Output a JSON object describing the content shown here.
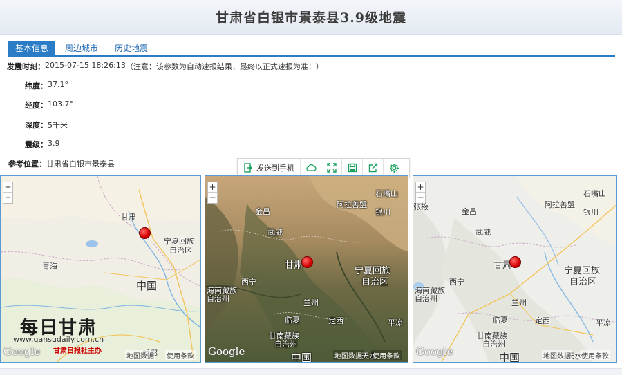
{
  "page": {
    "title": "甘肃省白银市景泰县3.9级地震"
  },
  "tabs": [
    {
      "label": "基本信息",
      "active": true
    },
    {
      "label": "周边城市",
      "active": false
    },
    {
      "label": "历史地震",
      "active": false
    }
  ],
  "info": {
    "time_label": "发震时刻：",
    "time_value": "2015-07-15 18:26:13",
    "time_note": "（注意：该参数为自动速报结果，最终以正式速报为准！）",
    "lat_label": "纬度：",
    "lat_value": "37.1°",
    "lon_label": "经度：",
    "lon_value": "103.7°",
    "depth_label": "深度：",
    "depth_value": "5千米",
    "mag_label": "震级：",
    "mag_value": "3.9",
    "loc_label": "参考位置：",
    "loc_value": "甘肃省白银市景泰县"
  },
  "toolbar": {
    "send_label": "发送到手机",
    "icons": [
      "phone-send-icon",
      "cloud-icon",
      "fullscreen-icon",
      "save-icon",
      "share-icon",
      "gear-icon"
    ],
    "accent": "#19a15f"
  },
  "map_common": {
    "zoom_in": "+",
    "zoom_out": "−",
    "google": "Google",
    "data_label": "地图数据",
    "terms_label": "使用条款"
  },
  "map1": {
    "labels": {
      "gansu": "甘肃",
      "ningxia": "宁夏回族",
      "ningxia2": "自治区",
      "qinghai": "青海",
      "china": "中国",
      "chengdu": "成都"
    },
    "watermark": {
      "logo": "每日甘肃",
      "url": "www.gansudaily.com.cn",
      "sub": "甘肃日报社主办"
    }
  },
  "map2": {
    "labels": {
      "shizuishan": "石嘴山",
      "alashan": "阿拉善盟",
      "jinchang": "金昌",
      "yinchuan": "银川",
      "wuwei": "武威",
      "gansu": "甘肃",
      "ningxia": "宁夏回族",
      "ningxia2": "自治区",
      "xining": "西宁",
      "haibei": "海南藏族",
      "haibei2": "自治州",
      "lanzhou": "兰州",
      "linxia": "临夏",
      "dingxi": "定西",
      "pingliang": "平凉",
      "gannan": "甘南藏族",
      "gannan2": "自治州",
      "china": "中国",
      "tianshui": "天水"
    }
  },
  "map3": {
    "labels": {
      "shizuishan": "石嘴山",
      "alashan": "阿拉善盟",
      "zhangye": "张掖",
      "jinchang": "金昌",
      "yinchuan": "银川",
      "wuwei": "武威",
      "gansu": "甘肃",
      "ningxia": "宁夏回族",
      "ningxia2": "自治区",
      "xining": "西宁",
      "haibei": "海南藏族",
      "haibei2": "自治州",
      "lanzhou": "兰州",
      "linxia": "临夏",
      "dingxi": "定西",
      "pingliang": "平凉",
      "gannan": "甘南藏族",
      "gannan2": "自治州",
      "china": "中国",
      "tianshui": "天水"
    }
  }
}
